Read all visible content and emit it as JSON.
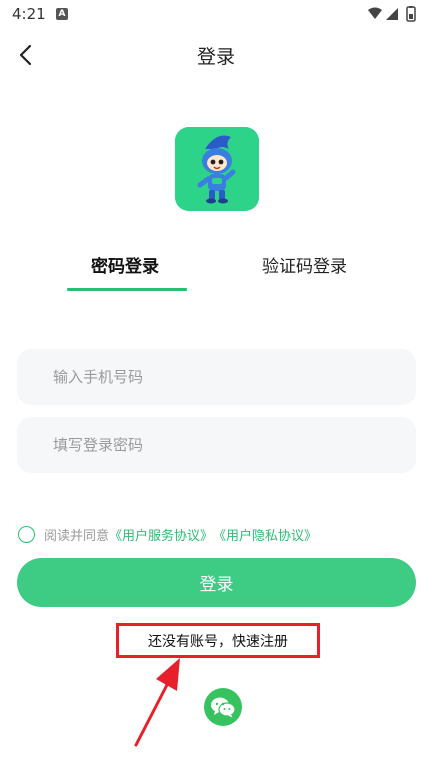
{
  "status_bar": {
    "time": "4:21",
    "indicator": "A"
  },
  "nav": {
    "title": "登录",
    "back_icon": "chevron-left-icon"
  },
  "app_icon": "mascot-logo",
  "tabs": [
    {
      "label": "密码登录",
      "active": true
    },
    {
      "label": "验证码登录",
      "active": false
    }
  ],
  "form": {
    "phone_placeholder": "输入手机号码",
    "password_placeholder": "填写登录密码"
  },
  "agreement": {
    "prefix": "阅读并同意",
    "service_link": "《用户服务协议》",
    "privacy_link": "《用户隐私协议》",
    "checked": false
  },
  "login_button": "登录",
  "register_link": "还没有账号，快速注册",
  "colors": {
    "accent": "#2bbd74",
    "button": "#3ecb84",
    "highlight_box": "#e8202a"
  }
}
